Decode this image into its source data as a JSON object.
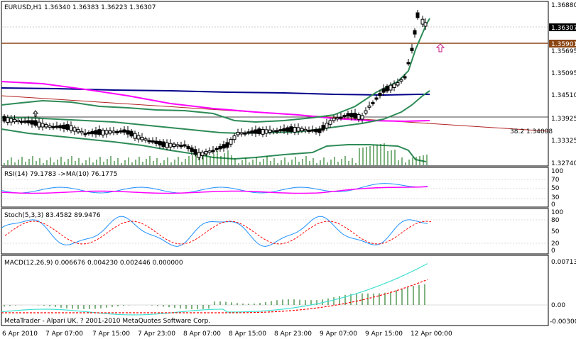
{
  "main": {
    "header": "EURUSD,H1  1.36340 1.36383 1.36223 1.36307",
    "fib_label": "38.2  1.34008",
    "price_ticks": [
      "1.36880",
      "1.36307",
      "1.35901",
      "1.35695",
      "1.35095",
      "1.34510",
      "1.33925",
      "1.33325",
      "1.32740"
    ],
    "current_price": "1.36307",
    "level_price": "1.35901",
    "colors": {
      "bull_body": "#ffffff",
      "bear_body": "#000000",
      "bollinger": "#2e8b57",
      "ma_blue": "#00008b",
      "ma_magenta": "#ff00ff",
      "hline": "#8b4513",
      "fib": "#b22222",
      "volume": "#006400"
    }
  },
  "rsi": {
    "header": "RSI(14) 79.1783  ->MA(10) 76.1775",
    "ticks": [
      "100",
      "70",
      "50",
      "30",
      "0"
    ]
  },
  "stoch": {
    "header": "Stoch(5,3,3) 83.4582 89.9476",
    "ticks": [
      "100",
      "80",
      "50",
      "20",
      "0"
    ]
  },
  "macd": {
    "header": "MACD(12,26,9) 0.006676 0.004230 0.002446 0.000000",
    "ticks": [
      "0.00713",
      "0.00",
      "-0.00300"
    ],
    "copyright": "MetaTrader - Alpari UK, ? 2001-2010 MetaQuotes Software Corp."
  },
  "time_axis": [
    "6 Apr 2010",
    "7 Apr 07:00",
    "7 Apr 15:00",
    "7 Apr 23:00",
    "8 Apr 07:00",
    "8 Apr 15:00",
    "8 Apr 23:00",
    "9 Apr 07:00",
    "9 Apr 15:00",
    "12 Apr 00:00"
  ]
}
